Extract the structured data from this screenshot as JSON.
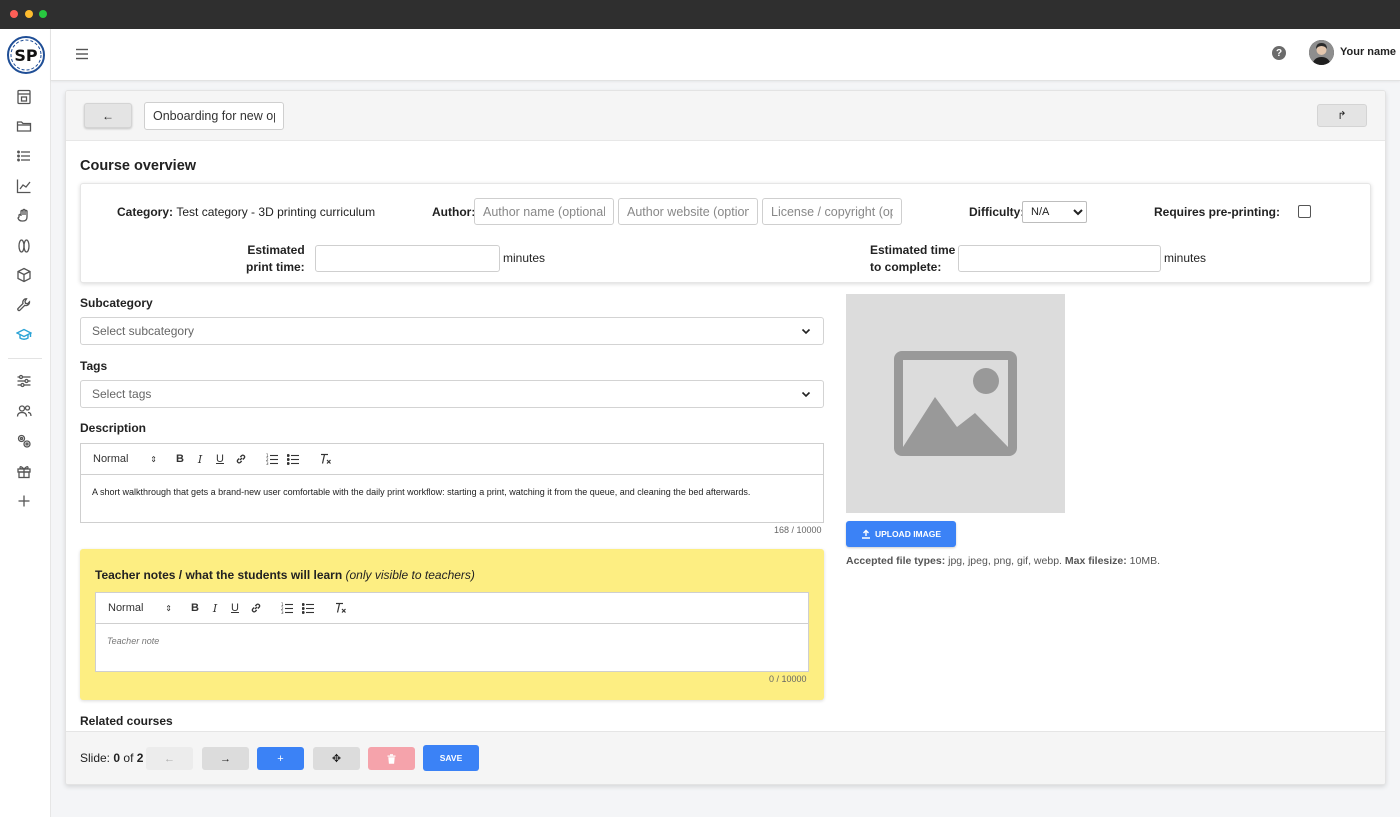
{
  "header": {
    "user_name": "Your name",
    "help_label": "?"
  },
  "sidebar": {
    "logo_text": "SP",
    "items": [
      {
        "icon": "printer-icon"
      },
      {
        "icon": "folder-icon"
      },
      {
        "icon": "list-icon"
      },
      {
        "icon": "chart-line-icon"
      },
      {
        "icon": "hand-icon"
      },
      {
        "icon": "spools-icon"
      },
      {
        "icon": "cube-icon"
      },
      {
        "icon": "wrench-icon"
      },
      {
        "icon": "graduation-cap-icon",
        "active": true
      },
      {
        "icon": "sliders-icon"
      },
      {
        "icon": "users-icon"
      },
      {
        "icon": "gears-icon"
      },
      {
        "icon": "gift-icon"
      },
      {
        "icon": "plus-icon"
      }
    ],
    "active_color": "#2aa3d6"
  },
  "course": {
    "title_value": "Onboarding for new operators",
    "back_icon": "←",
    "share_icon": "↱",
    "overview_heading": "Course overview",
    "category_label": "Category:",
    "category_value": "Test category - 3D printing curriculum",
    "author_label": "Author:",
    "author_name_placeholder": "Author name (optional)",
    "author_website_placeholder": "Author website (optional)",
    "license_placeholder": "License / copyright (optional)",
    "difficulty_label": "Difficulty:",
    "difficulty_value": "N/A",
    "preprint_label": "Requires pre-printing:",
    "est_print_label_1": "Estimated",
    "est_print_label_2": "print time:",
    "est_complete_label_1": "Estimated time",
    "est_complete_label_2": "to complete:",
    "minutes": "minutes",
    "subcategory_label": "Subcategory",
    "subcategory_placeholder": "Select subcategory",
    "tags_label": "Tags",
    "tags_placeholder": "Select tags",
    "description_label": "Description",
    "description_format": "Normal",
    "description_text": "A short walkthrough that gets a brand-new user comfortable with the daily print workflow: starting a print, watching it from the queue, and cleaning the bed afterwards.",
    "description_counter": "168 / 10000",
    "notes_title": "Teacher notes / what the students will learn",
    "notes_subtitle": "(only visible to teachers)",
    "notes_format": "Normal",
    "notes_placeholder": "Teacher note",
    "notes_counter": "0 / 10000",
    "upload_label": "UPLOAD IMAGE",
    "accepted_label": "Accepted file types:",
    "accepted_value": "jpg, jpeg, png, gif, webp.",
    "maxsize_label": "Max filesize:",
    "maxsize_value": "10MB.",
    "related_label": "Related courses"
  },
  "footer": {
    "slide_prefix": "Slide:",
    "slide_current": "0",
    "slide_of": "of",
    "slide_total": "2",
    "prev_icon": "←",
    "next_icon": "→",
    "add_icon": "+",
    "move_icon": "✥",
    "save_label": "SAVE"
  },
  "colors": {
    "primary": "#3b82f6",
    "notes_bg": "#fdee82",
    "delete_bg": "#f5a3ab"
  }
}
